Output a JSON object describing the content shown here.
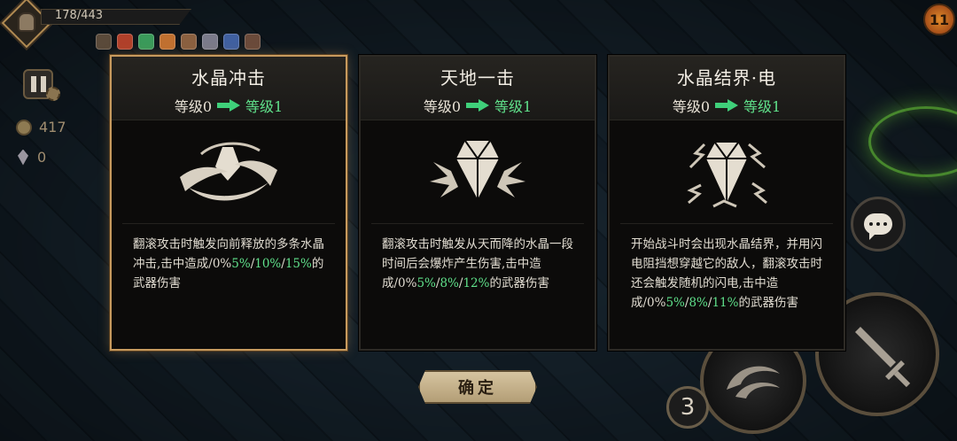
{
  "hud": {
    "hp_text": "178/443",
    "coins": "417",
    "gems": "0",
    "timer": "11",
    "skill_charges": "3"
  },
  "cards": [
    {
      "title": "水晶冲击",
      "level_from": "等级0",
      "level_to": "等级1",
      "icon": "crystal-burst-icon",
      "selected": true,
      "desc_prefix": "翻滚攻击时触发向前释放的多条水晶冲击,击中造成/0%",
      "values": [
        "5%",
        "10%",
        "15%"
      ],
      "desc_suffix": "的武器伤害"
    },
    {
      "title": "天地一击",
      "level_from": "等级0",
      "level_to": "等级1",
      "icon": "crystal-drop-icon",
      "selected": false,
      "desc_prefix": "翻滚攻击时触发从天而降的水晶一段时间后会爆炸产生伤害,击中造成/0%",
      "values": [
        "5%",
        "8%",
        "12%"
      ],
      "desc_suffix": "的武器伤害"
    },
    {
      "title": "水晶结界·电",
      "level_from": "等级0",
      "level_to": "等级1",
      "icon": "crystal-lightning-icon",
      "selected": false,
      "desc_prefix": "开始战斗时会出现水晶结界，并用闪电阻挡想穿越它的敌人，翻滚攻击时还会触发随机的闪电,击中造成/0%",
      "values": [
        "5%",
        "8%",
        "11%"
      ],
      "desc_suffix": "的武器伤害"
    }
  ],
  "confirm_label": "确定",
  "colors": {
    "selected_border": "#c79a5e",
    "green": "#5fe08a",
    "card_bg": "#0c0b0a"
  }
}
